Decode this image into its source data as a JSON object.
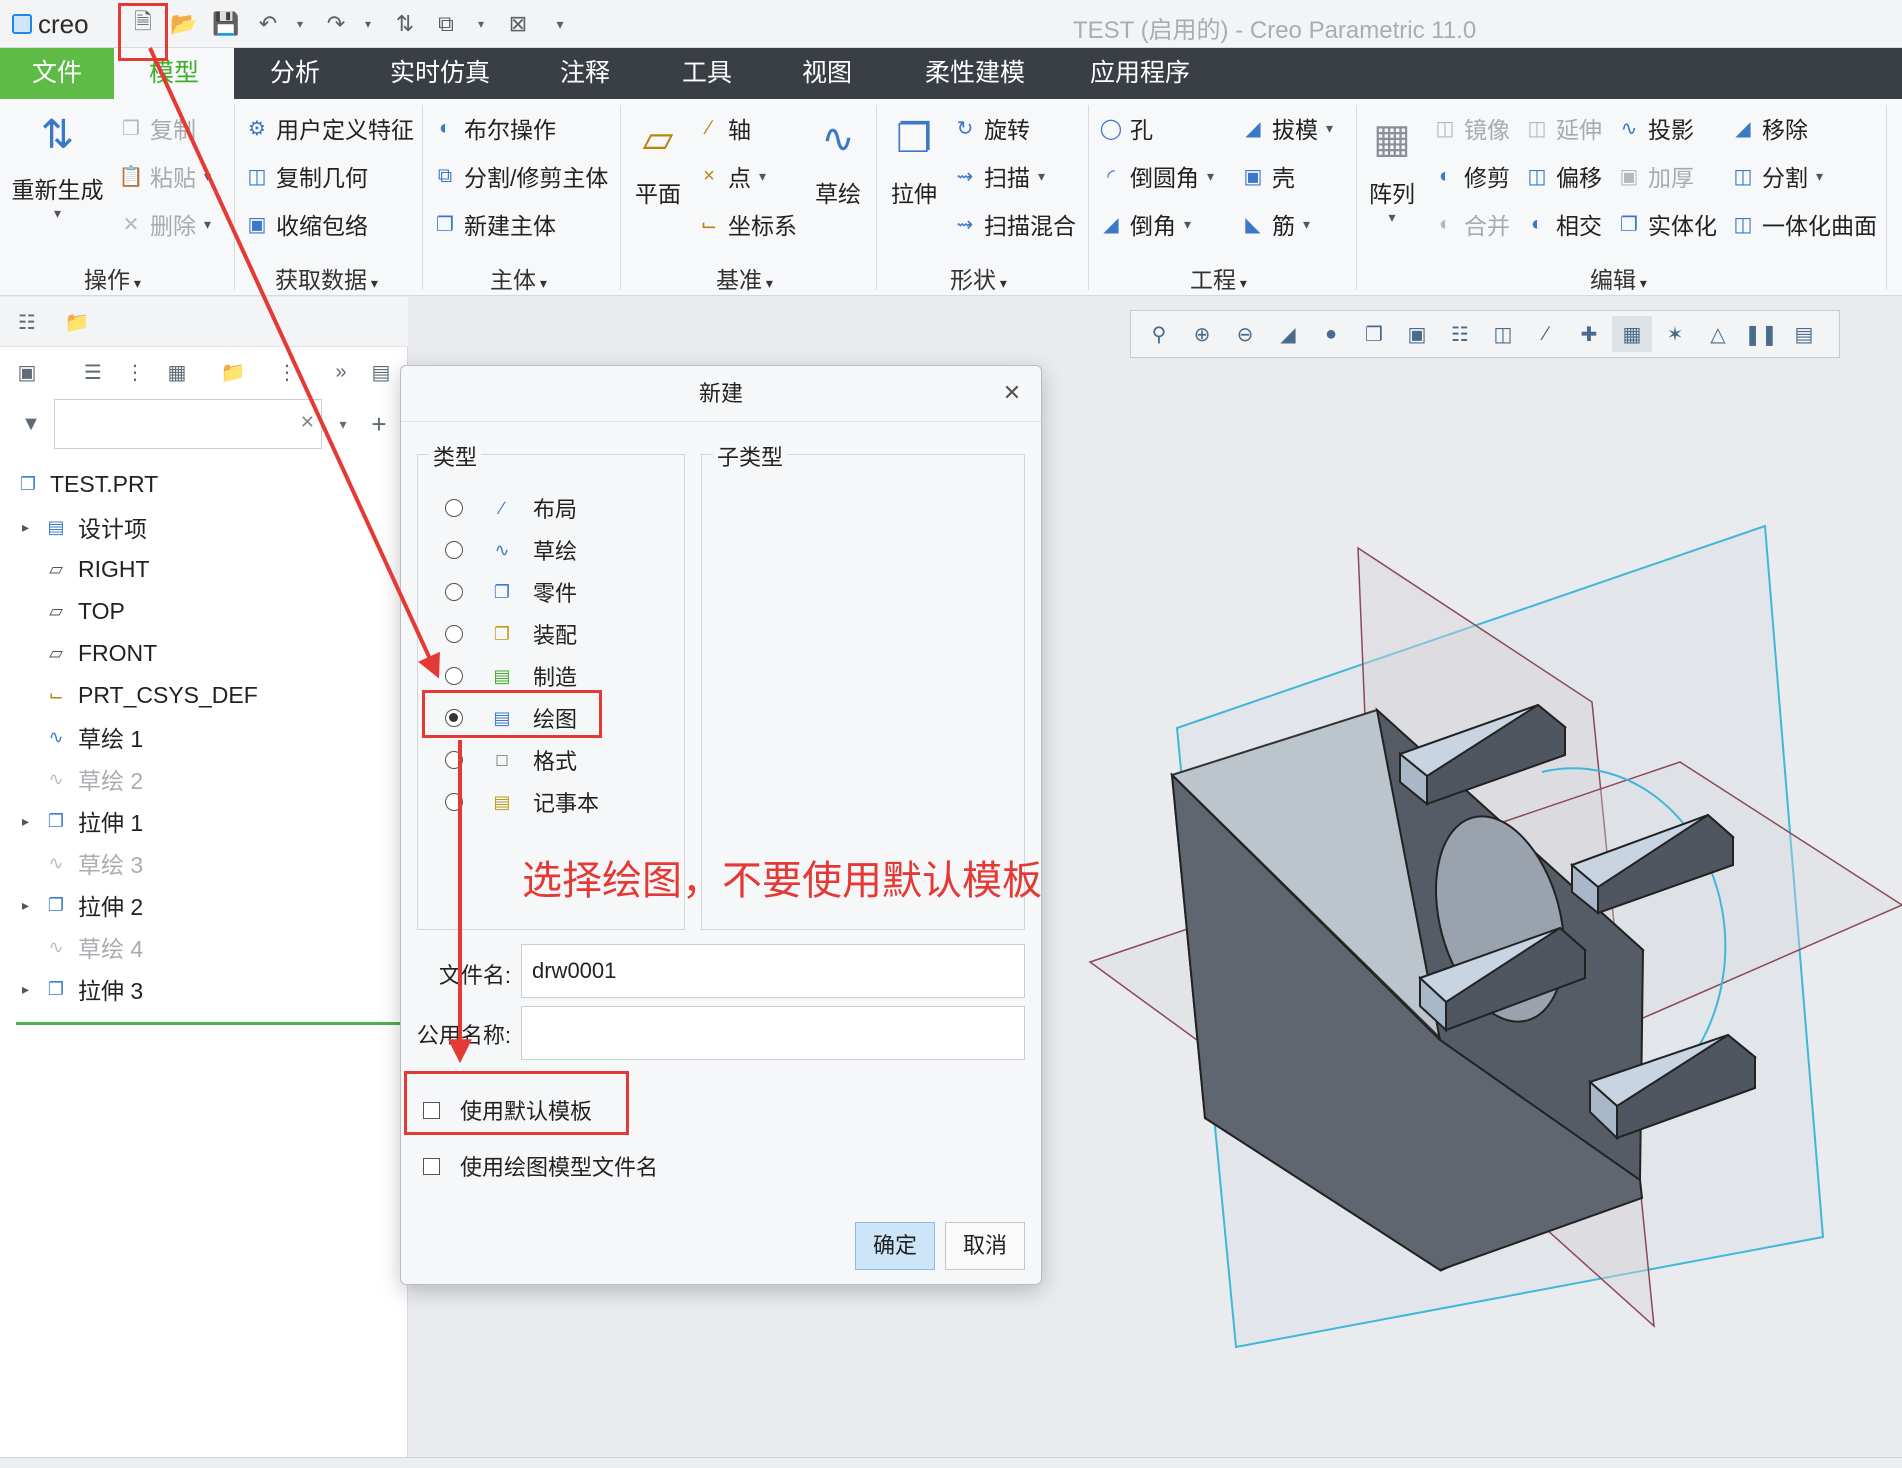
{
  "app": {
    "logo_text": "creo",
    "window_title": "TEST (启用的) - Creo Parametric 11.0"
  },
  "ribbon_tabs": [
    "文件",
    "模型",
    "分析",
    "实时仿真",
    "注释",
    "工具",
    "视图",
    "柔性建模",
    "应用程序"
  ],
  "ribbon": {
    "regenerate": "重新生成",
    "copy": "复制",
    "paste": "粘贴",
    "delete": "删除",
    "udf": "用户定义特征",
    "copy_geom": "复制几何",
    "shrinkwrap": "收缩包络",
    "boolean": "布尔操作",
    "split_body": "分割/修剪主体",
    "new_body": "新建主体",
    "plane": "平面",
    "axis": "轴",
    "point": "点",
    "csys": "坐标系",
    "sketch": "草绘",
    "extrude": "拉伸",
    "revolve": "旋转",
    "sweep": "扫描",
    "swept_blend": "扫描混合",
    "hole": "孔",
    "round": "倒圆角",
    "chamfer": "倒角",
    "draft": "拔模",
    "shell": "壳",
    "rib": "筋",
    "pattern": "阵列",
    "mirror": "镜像",
    "trim": "修剪",
    "merge": "合并",
    "extend": "延伸",
    "offset": "偏移",
    "intersect": "相交",
    "project": "投影",
    "thicken": "加厚",
    "solidify": "实体化",
    "remove": "移除",
    "split": "分割",
    "unify": "一体化曲面",
    "groups": {
      "operations": "操作",
      "get_data": "获取数据",
      "body": "主体",
      "datum": "基准",
      "shapes": "形状",
      "engineering": "工程",
      "editing": "编辑"
    }
  },
  "model_tree": {
    "filter_placeholder": "",
    "items": [
      {
        "label": "TEST.PRT",
        "icon": "part-icon"
      },
      {
        "label": "设计项",
        "icon": "design-items-icon"
      },
      {
        "label": "RIGHT",
        "icon": "datum-plane-icon"
      },
      {
        "label": "TOP",
        "icon": "datum-plane-icon"
      },
      {
        "label": "FRONT",
        "icon": "datum-plane-icon"
      },
      {
        "label": "PRT_CSYS_DEF",
        "icon": "csys-icon"
      },
      {
        "label": "草绘 1",
        "icon": "sketch-icon"
      },
      {
        "label": "草绘 2",
        "icon": "sketch-icon"
      },
      {
        "label": "拉伸 1",
        "icon": "extrude-icon"
      },
      {
        "label": "草绘 3",
        "icon": "sketch-icon"
      },
      {
        "label": "拉伸 2",
        "icon": "extrude-icon"
      },
      {
        "label": "草绘 4",
        "icon": "sketch-icon"
      },
      {
        "label": "拉伸 3",
        "icon": "extrude-icon"
      }
    ]
  },
  "dialog": {
    "title": "新建",
    "type_label": "类型",
    "subtype_label": "子类型",
    "types": [
      "布局",
      "草绘",
      "零件",
      "装配",
      "制造",
      "绘图",
      "格式",
      "记事本"
    ],
    "selected_type": "绘图",
    "filename_label": "文件名:",
    "filename_value": "drw0001",
    "common_name_label": "公用名称:",
    "common_name_value": "",
    "use_default_template": "使用默认模板",
    "use_drawing_model_name": "使用绘图模型文件名",
    "ok": "确定",
    "cancel": "取消"
  },
  "annotation": {
    "text": "选择绘图，不要使用默认模板",
    "color": "#e53935"
  },
  "colors": {
    "file_tab": "#5dbb46",
    "tabbar": "#3a3f45",
    "accent_green": "#3fae2a",
    "primary_button": "#cde5f8"
  }
}
